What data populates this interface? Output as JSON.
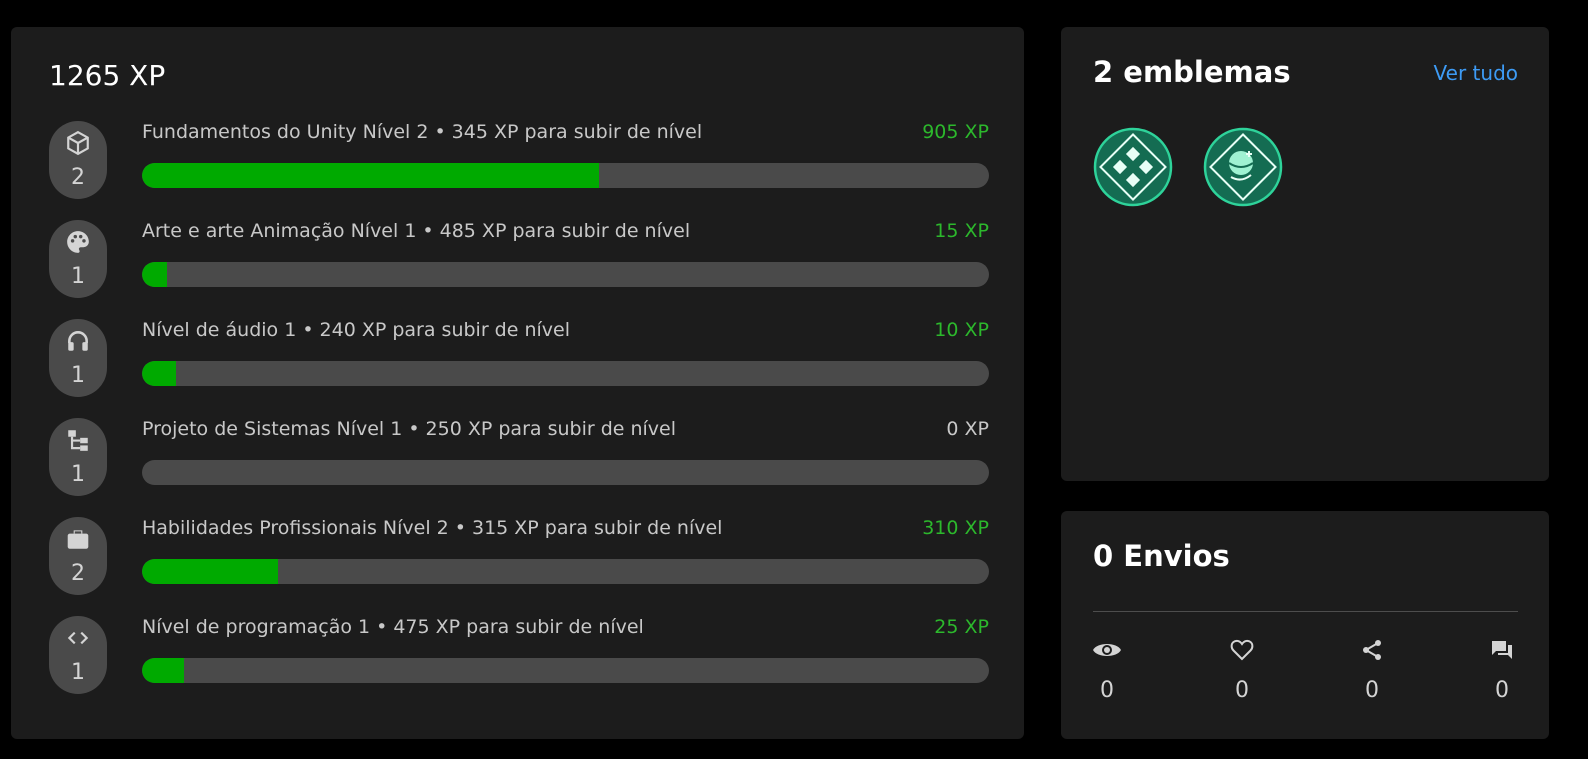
{
  "xp_card": {
    "total_label": "1265 XP",
    "skills": [
      {
        "icon": "unity-cube-icon",
        "level": "2",
        "name": "Fundamentos do Unity Nível 2",
        "separator": "•",
        "to_next": "345 XP para subir de nível",
        "xp": "905 XP",
        "progress_fraction": 0.54
      },
      {
        "icon": "palette-icon",
        "level": "1",
        "name": "Arte e arte Animação Nível 1",
        "separator": "•",
        "to_next": "485 XP para subir de nível",
        "xp": "15 XP",
        "progress_fraction": 0.03
      },
      {
        "icon": "headphones-icon",
        "level": "1",
        "name": "Nível de áudio 1",
        "separator": "•",
        "to_next": "240 XP para subir de nível",
        "xp": "10 XP",
        "progress_fraction": 0.04
      },
      {
        "icon": "system-tree-icon",
        "level": "1",
        "name": "Projeto de Sistemas Nível 1",
        "separator": "•",
        "to_next": "250 XP para subir de nível",
        "xp": "0 XP",
        "progress_fraction": 0.0
      },
      {
        "icon": "briefcase-icon",
        "level": "2",
        "name": "Habilidades Profissionais Nível 2",
        "separator": "•",
        "to_next": "315 XP para subir de nível",
        "xp": "310 XP",
        "progress_fraction": 0.16
      },
      {
        "icon": "code-brackets-icon",
        "level": "1",
        "name": "Nível de programação 1",
        "separator": "•",
        "to_next": "475 XP para subir de nível",
        "xp": "25 XP",
        "progress_fraction": 0.05
      }
    ]
  },
  "badges_card": {
    "title": "2 emblemas",
    "view_all_label": "Ver tudo",
    "badges": [
      {
        "icon": "tiles-badge-icon"
      },
      {
        "icon": "globe-badge-icon"
      }
    ]
  },
  "submissions_card": {
    "title": "0 Envios",
    "stats": [
      {
        "icon": "eye-icon",
        "value": "0"
      },
      {
        "icon": "heart-icon",
        "value": "0"
      },
      {
        "icon": "share-icon",
        "value": "0"
      },
      {
        "icon": "comment-icon",
        "value": "0"
      }
    ]
  },
  "colors": {
    "background": "#000000",
    "card": "#1c1c1c",
    "progress_fill": "#00aa00",
    "progress_track": "#4a4a4a",
    "xp_green": "#2cb82c",
    "link_blue": "#3d9bf5",
    "badge_teal": "#2ed39a"
  }
}
